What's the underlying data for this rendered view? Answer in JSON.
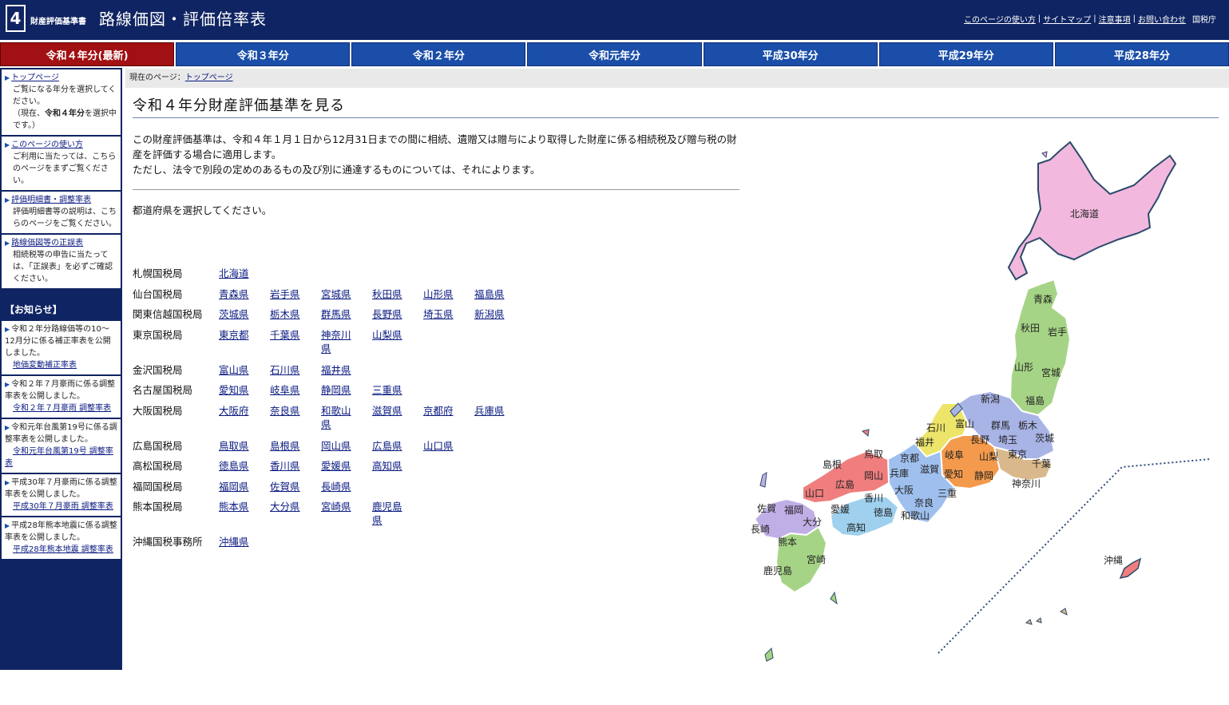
{
  "header": {
    "logo_number": "4",
    "logo_small": "財産評価基準書",
    "logo_main": "路線価図・評価倍率表",
    "links": [
      {
        "label": "このページの使い方"
      },
      {
        "label": "サイトマップ"
      },
      {
        "label": "注意事項"
      },
      {
        "label": "お問い合わせ"
      }
    ],
    "agency": "国税庁"
  },
  "tabs": [
    {
      "label": "令和４年分(最新)",
      "active": true
    },
    {
      "label": "令和３年分"
    },
    {
      "label": "令和２年分"
    },
    {
      "label": "令和元年分"
    },
    {
      "label": "平成30年分"
    },
    {
      "label": "平成29年分"
    },
    {
      "label": "平成28年分"
    }
  ],
  "sidebar": {
    "items": [
      {
        "link": "トップページ",
        "text_a": "ご覧になる年分を選択してください。",
        "text_b": "（現在、",
        "bold": "令和４年分",
        "text_c": "を選択中です。）"
      },
      {
        "link": "このページの使い方",
        "text": "ご利用に当たっては、こちらのページをまずご覧ください。"
      },
      {
        "link": "評価明細書・調整率表",
        "text": "評価明細書等の説明は、こちらのページをご覧ください。"
      },
      {
        "link": "路線価図等の正誤表",
        "text": "相続税等の申告に当たっては、「正誤表」を必ずご確認ください。"
      }
    ],
    "notice_title": "【お知らせ】",
    "notices": [
      {
        "text": "令和２年分路線価等の10～12月分に係る補正率表を公開しました。",
        "link": "地価変動補正率表"
      },
      {
        "text": "令和２年７月豪雨に係る調整率表を公開しました。",
        "link": "令和２年７月豪雨 調整率表"
      },
      {
        "text": "令和元年台風第19号に係る調整率表を公開しました。",
        "link": "令和元年台風第19号 調整率表"
      },
      {
        "text": "平成30年７月豪雨に係る調整率表を公開しました。",
        "link": "平成30年７月豪雨 調整率表"
      },
      {
        "text": "平成28年熊本地震に係る調整率表を公開しました。",
        "link": "平成28年熊本地震 調整率表"
      }
    ]
  },
  "breadcrumb": {
    "prefix": "現在のページ：",
    "current": "トップページ"
  },
  "main": {
    "title": "令和４年分財産評価基準を見る",
    "intro_line1": "この財産評価基準は、令和４年１月１日から12月31日までの間に相続、遺贈又は贈与により取得した財産に係る相続税及び贈与税の財産を評価する場合に適用します。",
    "intro_line2": "ただし、法令で別段の定めのあるもの及び別に通達するものについては、それによります。",
    "select_prompt": "都道府県を選択してください。"
  },
  "bureaus": [
    {
      "name": "札幌国税局",
      "prefs": [
        "北海道"
      ]
    },
    {
      "name": "仙台国税局",
      "prefs": [
        "青森県",
        "岩手県",
        "宮城県",
        "秋田県",
        "山形県",
        "福島県"
      ]
    },
    {
      "name": "関東信越国税局",
      "prefs": [
        "茨城県",
        "栃木県",
        "群馬県",
        "長野県",
        "埼玉県",
        "新潟県"
      ]
    },
    {
      "name": "東京国税局",
      "prefs": [
        "東京都",
        "千葉県",
        "神奈川県",
        "山梨県"
      ]
    },
    {
      "name": "金沢国税局",
      "prefs": [
        "富山県",
        "石川県",
        "福井県"
      ]
    },
    {
      "name": "名古屋国税局",
      "prefs": [
        "愛知県",
        "岐阜県",
        "静岡県",
        "三重県"
      ]
    },
    {
      "name": "大阪国税局",
      "prefs": [
        "大阪府",
        "奈良県",
        "和歌山県",
        "滋賀県",
        "京都府",
        "兵庫県"
      ]
    },
    {
      "name": "広島国税局",
      "prefs": [
        "鳥取県",
        "島根県",
        "岡山県",
        "広島県",
        "山口県"
      ]
    },
    {
      "name": "高松国税局",
      "prefs": [
        "徳島県",
        "香川県",
        "愛媛県",
        "高知県"
      ]
    },
    {
      "name": "福岡国税局",
      "prefs": [
        "福岡県",
        "佐賀県",
        "長崎県"
      ]
    },
    {
      "name": "熊本国税局",
      "prefs": [
        "熊本県",
        "大分県",
        "宮崎県",
        "鹿児島県"
      ]
    },
    {
      "name": "沖縄国税事務所",
      "prefs": [
        "沖縄県"
      ]
    }
  ],
  "map": {
    "labels": {
      "hokkaido": "北海道",
      "aomori": "青森",
      "akita": "秋田",
      "iwate": "岩手",
      "yamagata": "山形",
      "miyagi": "宮城",
      "niigata": "新潟",
      "fukushima": "福島",
      "gunma": "群馬",
      "tochigi": "栃木",
      "ibaraki": "茨城",
      "toyama": "富山",
      "ishikawa": "石川",
      "fukui": "福井",
      "nagano": "長野",
      "saitama": "埼玉",
      "gifu": "岐阜",
      "yamanashi": "山梨",
      "tokyo": "東京",
      "chiba": "千葉",
      "kanagawa": "神奈川",
      "shizuoka": "静岡",
      "aichi": "愛知",
      "mie": "三重",
      "shiga": "滋賀",
      "kyoto": "京都",
      "hyogo": "兵庫",
      "osaka": "大阪",
      "nara": "奈良",
      "wakayama": "和歌山",
      "tottori": "鳥取",
      "shimane": "島根",
      "okayama": "岡山",
      "hiroshima": "広島",
      "yamaguchi": "山口",
      "kagawa": "香川",
      "tokushima": "徳島",
      "ehime": "愛媛",
      "kochi": "高知",
      "fukuoka": "福岡",
      "saga": "佐賀",
      "nagasaki": "長崎",
      "oita": "大分",
      "kumamoto": "熊本",
      "miyazaki": "宮崎",
      "kagoshima": "鹿児島",
      "okinawa": "沖縄"
    },
    "colors": {
      "hokkaido": "#f2b8de",
      "tohoku": "#a6d486",
      "kanto": "#a9b4e6",
      "tokyo": "#d9b98c",
      "hokuriku": "#ede56a",
      "tokai": "#f49a4c",
      "kinki": "#9fc0ee",
      "chugoku": "#f07e7e",
      "shikoku": "#9fd0ee",
      "kyushu": "#c0aee6",
      "south": "#a6d486",
      "okinawa": "#f07e7e"
    }
  }
}
